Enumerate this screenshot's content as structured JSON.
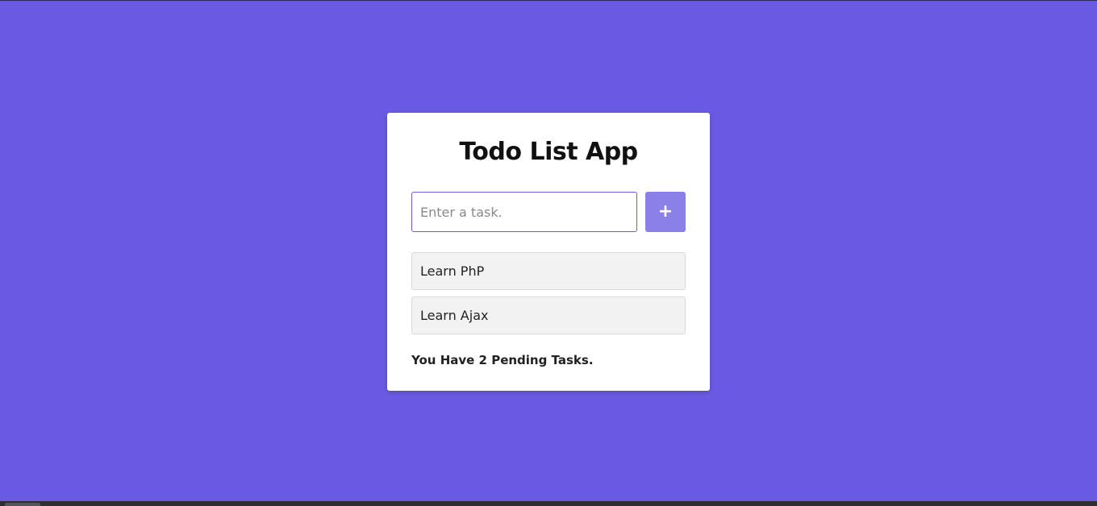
{
  "app": {
    "title": "Todo List App"
  },
  "input": {
    "value": "",
    "placeholder": "Enter a task."
  },
  "add_button": {
    "icon": "plus-icon",
    "label": "+"
  },
  "tasks": [
    {
      "label": "Learn PhP"
    },
    {
      "label": "Learn Ajax"
    }
  ],
  "footer": {
    "pending_text": "You Have 2 Pending Tasks."
  },
  "colors": {
    "background": "#6a5ae3",
    "accent_button": "#8b7fe8",
    "card": "#ffffff",
    "task_item": "#f2f2f2"
  }
}
